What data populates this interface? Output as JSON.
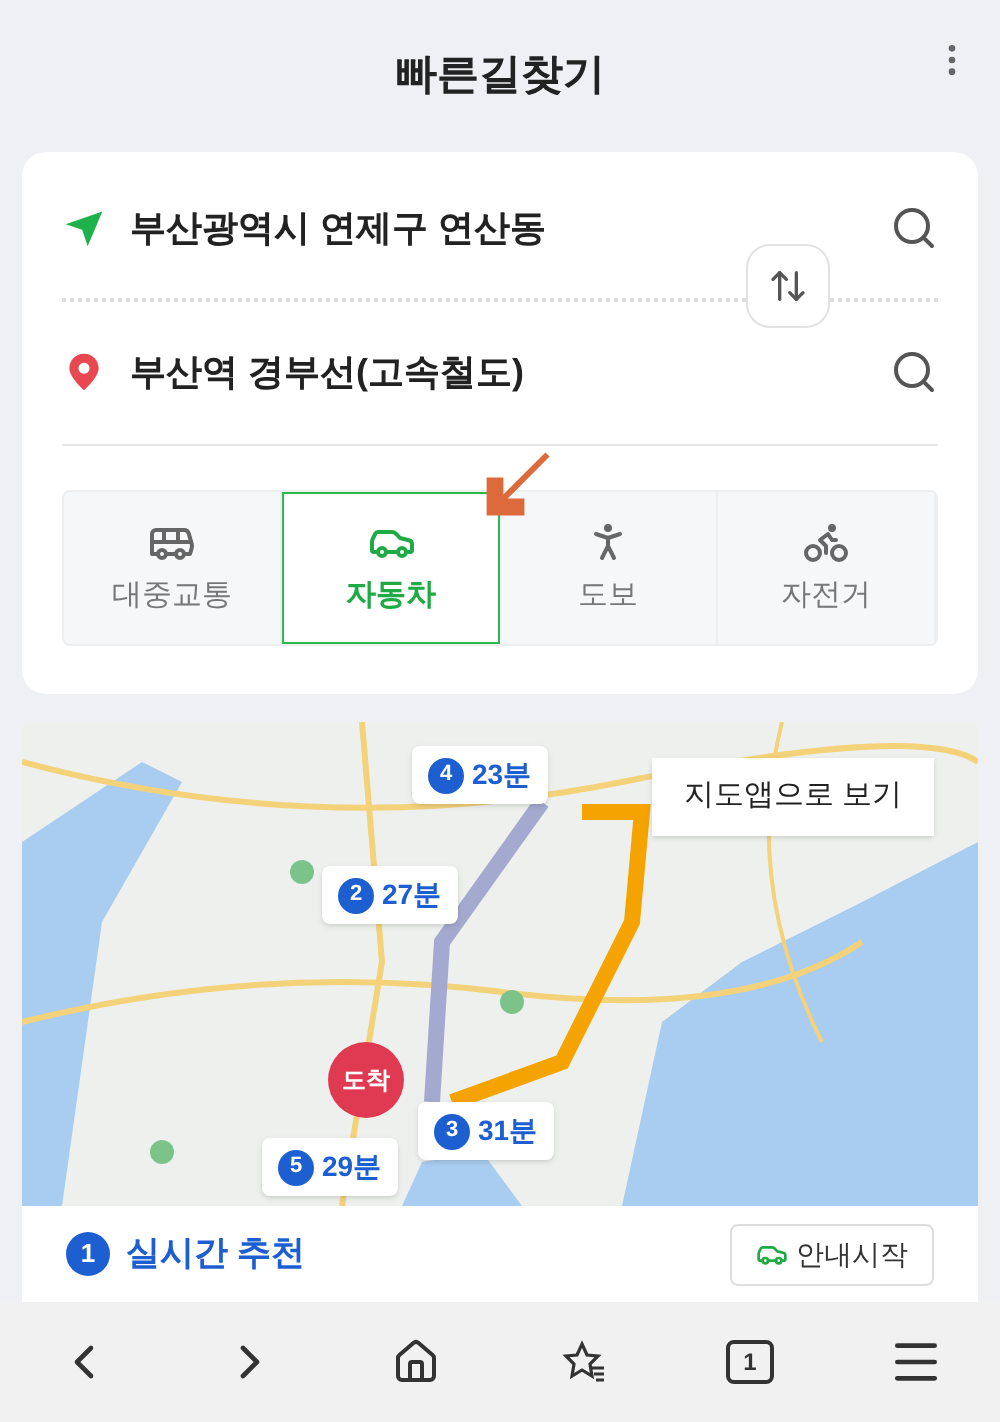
{
  "header": {
    "title": "빠른길찾기"
  },
  "origin": {
    "value": "부산광역시 연제구 연산동"
  },
  "destination": {
    "value": "부산역 경부선(고속철도)"
  },
  "modes": [
    {
      "kind": "bus",
      "label": "대중교통",
      "selected": false
    },
    {
      "kind": "car",
      "label": "자동차",
      "selected": true
    },
    {
      "kind": "walk",
      "label": "도보",
      "selected": false
    },
    {
      "kind": "bike",
      "label": "자전거",
      "selected": false
    }
  ],
  "map": {
    "open_button": "지도앱으로 보기",
    "arrival_marker": "도착",
    "route_badges": [
      {
        "number": "4",
        "time": "23분"
      },
      {
        "number": "2",
        "time": "27분"
      },
      {
        "number": "3",
        "time": "31분"
      },
      {
        "number": "5",
        "time": "29분"
      }
    ]
  },
  "result": {
    "number": "1",
    "title": "실시간 추천",
    "button": "안내시작"
  },
  "bottom_nav": {
    "tab_count": "1"
  }
}
